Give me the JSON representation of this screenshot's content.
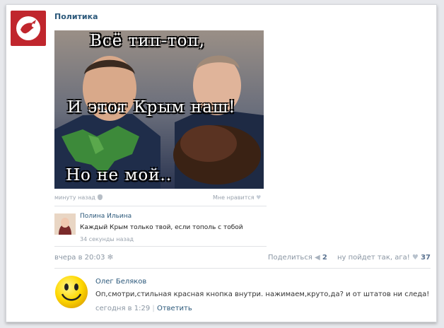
{
  "group": {
    "name": "Политика",
    "avatar_icon": "white-bird-icon",
    "avatar_color": "#c0262d"
  },
  "image": {
    "line1": "Всё тип-топ,",
    "line2": "И этот Крым наш!",
    "line3": "Но не мой.."
  },
  "photo_meta": {
    "time": "минуту назад",
    "likes_label": "Мне нравится"
  },
  "comment": {
    "author": "Полина Ильина",
    "text": "Каждый Крым только твой, если тополь с тобой",
    "time": "34 секунды назад"
  },
  "post_footer": {
    "time": "вчера в 20:03",
    "share_label": "Поделиться",
    "share_count": "2",
    "like_label": "ну пойдет так, ага!",
    "like_count": "37"
  },
  "reply": {
    "author": "Олег Беляков",
    "text": "Оп,смотри,стильная красная кнопка внутри. нажимаем,круто,да? и от штатов ни следа!",
    "time": "сегодня в 1:29",
    "separator": "|",
    "reply_label": "Ответить"
  },
  "colors": {
    "link": "#2b587a",
    "meta": "#8a96a3",
    "background": "#e7e8ec"
  }
}
